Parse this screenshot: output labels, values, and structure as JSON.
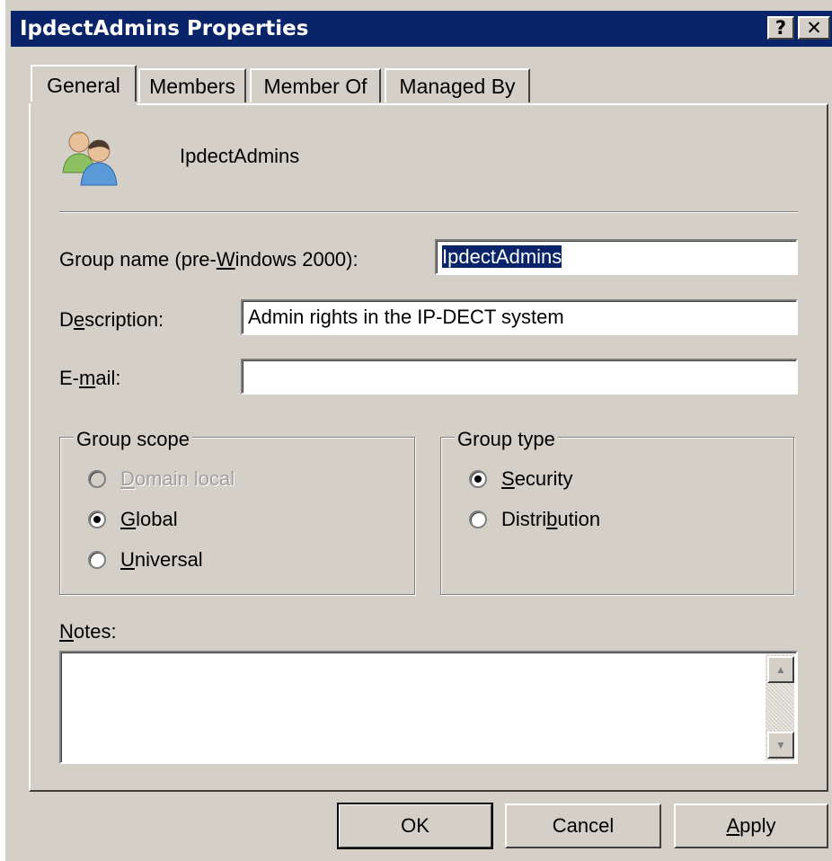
{
  "window": {
    "title": "IpdectAdmins Properties",
    "help_glyph": "?",
    "close_glyph": "✕"
  },
  "tabs": [
    {
      "label": "General",
      "active": true
    },
    {
      "label": "Members",
      "active": false
    },
    {
      "label": "Member Of",
      "active": false
    },
    {
      "label": "Managed By",
      "active": false
    }
  ],
  "header": {
    "icon": "user-group-icon",
    "group_display_name": "IpdectAdmins"
  },
  "fields": {
    "group_name_label": {
      "before": "Group name (pre-",
      "mnemonic": "W",
      "after": "indows 2000):"
    },
    "group_name_value": "IpdectAdmins",
    "description_label": {
      "before": "D",
      "mnemonic": "e",
      "after": "scription:"
    },
    "description_value": "Admin rights in the IP-DECT system",
    "email_label": {
      "before": "E-",
      "mnemonic": "m",
      "after": "ail:"
    },
    "email_value": ""
  },
  "group_scope": {
    "legend": "Group scope",
    "options": [
      {
        "before": "",
        "mnemonic": "D",
        "after": "omain local",
        "checked": false,
        "disabled": true
      },
      {
        "before": "",
        "mnemonic": "G",
        "after": "lobal",
        "checked": true,
        "disabled": false
      },
      {
        "before": "",
        "mnemonic": "U",
        "after": "niversal",
        "checked": false,
        "disabled": false
      }
    ]
  },
  "group_type": {
    "legend": "Group type",
    "options": [
      {
        "before": "",
        "mnemonic": "S",
        "after": "ecurity",
        "checked": true
      },
      {
        "before": "Distri",
        "mnemonic": "b",
        "after": "ution",
        "checked": false
      }
    ]
  },
  "notes": {
    "label": {
      "before": "",
      "mnemonic": "N",
      "after": "otes:"
    },
    "value": ""
  },
  "buttons": {
    "ok": "OK",
    "cancel": "Cancel",
    "apply": {
      "before": "",
      "mnemonic": "A",
      "after": "pply"
    }
  },
  "colors": {
    "title_bar": "#0a246a",
    "face": "#d4d0c8",
    "selection": "#0a246a"
  }
}
